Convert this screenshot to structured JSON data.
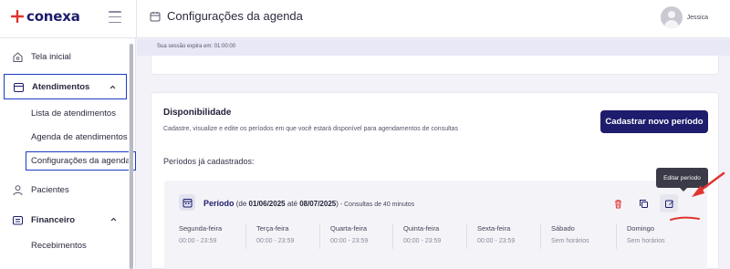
{
  "app": {
    "logo_text": "conexa",
    "brand_color": "#1e1c6c",
    "accent_red": "#e0342e"
  },
  "header": {
    "title": "Configurações da agenda",
    "user_name": "Jessica"
  },
  "session": {
    "text": "Sua sessão expira em: 01:00:00"
  },
  "sidebar": {
    "items": [
      {
        "label": "Tela inicial"
      },
      {
        "label": "Atendimentos"
      },
      {
        "label": "Pacientes"
      },
      {
        "label": "Financeiro"
      }
    ],
    "atendimentos_sub": [
      {
        "label": "Lista de atendimentos"
      },
      {
        "label": "Agenda de atendimentos"
      },
      {
        "label": "Configurações da agenda"
      }
    ],
    "financeiro_sub": [
      {
        "label": "Recebimentos"
      }
    ]
  },
  "availability": {
    "title": "Disponibilidade",
    "description": "Cadastre, visualize e edite os períodos em que você estará disponível para agendamentos de consultas",
    "cta_label": "Cadastrar novo período",
    "periods_label": "Períodos já cadastrados:",
    "tooltip": "Editar período",
    "period": {
      "label": "Período",
      "de": "(de",
      "start": "01/06/2025",
      "ate": "até",
      "end": "08/07/2025",
      "close": ")",
      "consult": " - Consultas de 40 minutos",
      "days": [
        {
          "name": "Segunda-feira",
          "hours": "00:00 - 23:59"
        },
        {
          "name": "Terça-feira",
          "hours": "00:00 - 23:59"
        },
        {
          "name": "Quarta-feira",
          "hours": "00:00 - 23:59"
        },
        {
          "name": "Quinta-feira",
          "hours": "00:00 - 23:59"
        },
        {
          "name": "Sexta-feira",
          "hours": "00:00 - 23:59"
        },
        {
          "name": "Sábado",
          "hours": "Sem horários"
        },
        {
          "name": "Domingo",
          "hours": "Sem horários"
        }
      ]
    }
  }
}
